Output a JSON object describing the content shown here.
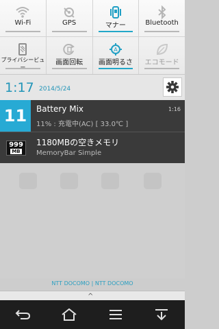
{
  "quick_settings": {
    "row1": [
      {
        "label": "Wi-Fi",
        "icon": "wifi-icon",
        "active": false
      },
      {
        "label": "GPS",
        "icon": "gps-icon",
        "active": false
      },
      {
        "label": "マナー",
        "icon": "vibrate-icon",
        "active": true
      },
      {
        "label": "Bluetooth",
        "icon": "bluetooth-icon",
        "active": false
      }
    ],
    "row2": [
      {
        "label": "プライバシービュー",
        "icon": "privacy-view-icon",
        "active": false
      },
      {
        "label": "画面回転",
        "icon": "rotate-icon",
        "active": false
      },
      {
        "label": "画面明るさ",
        "icon": "brightness-icon",
        "active": true
      },
      {
        "label": "エコモード",
        "icon": "eco-leaf-icon",
        "active": false
      }
    ]
  },
  "header": {
    "time": "1:17",
    "date": "2014/5/24"
  },
  "notifications": [
    {
      "badge": "11",
      "title": "Battery Mix",
      "subtitle": "11% : 充電中(AC) [ 33.0℃ ]",
      "time": "1:16"
    },
    {
      "icon_text": "999",
      "icon_sub": "MB",
      "title": "1180MBの空きメモリ",
      "subtitle": "MemoryBar Simple"
    }
  ],
  "carrier": "NTT DOCOMO | NTT DOCOMO",
  "handle_glyph": "^",
  "colors": {
    "accent": "#2295b8",
    "badge_blue": "#27aad4",
    "notification_bg": "#3a3a3a"
  }
}
